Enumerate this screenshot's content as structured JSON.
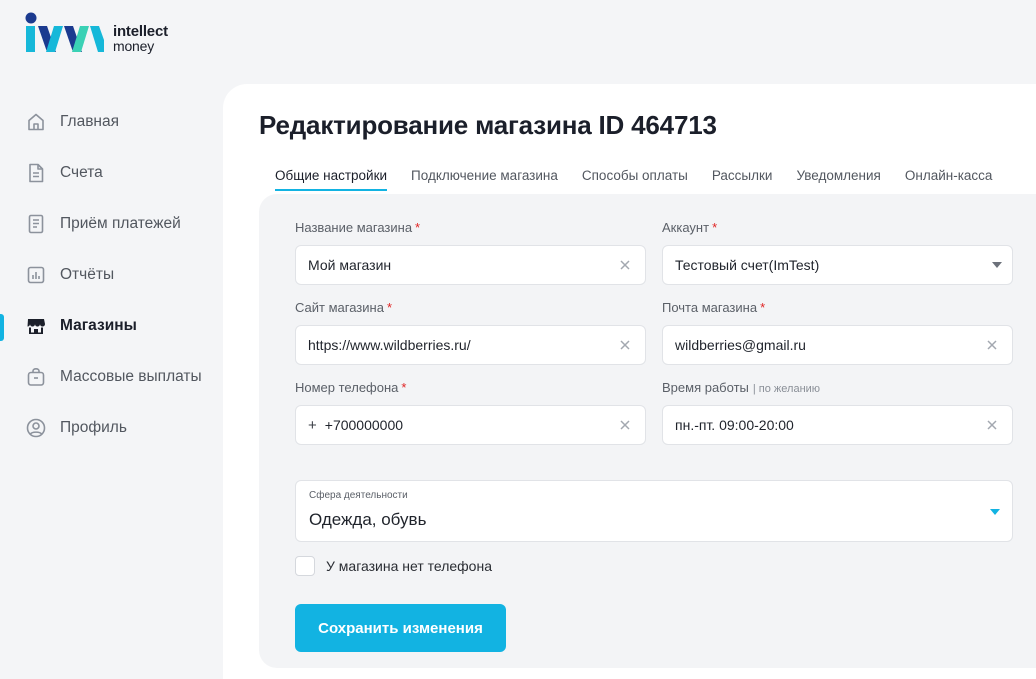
{
  "logo": {
    "line1": "intellect",
    "line2": "money"
  },
  "colors": {
    "accent": "#12b3e2",
    "required": "#e02424"
  },
  "sidebar": {
    "items": [
      {
        "label": "Главная",
        "icon": "home-icon"
      },
      {
        "label": "Счета",
        "icon": "document-icon"
      },
      {
        "label": "Приём платежей",
        "icon": "receipt-icon"
      },
      {
        "label": "Отчёты",
        "icon": "bar-chart-icon"
      },
      {
        "label": "Магазины",
        "icon": "store-icon",
        "active": true
      },
      {
        "label": "Массовые выплаты",
        "icon": "bag-icon"
      },
      {
        "label": "Профиль",
        "icon": "user-circle-icon"
      }
    ]
  },
  "page": {
    "title": "Редактирование магазина ID 464713"
  },
  "tabs": [
    {
      "label": "Общие настройки",
      "active": true
    },
    {
      "label": "Подключение магазина"
    },
    {
      "label": "Способы оплаты"
    },
    {
      "label": "Рассылки"
    },
    {
      "label": "Уведомления"
    },
    {
      "label": "Онлайн-касса"
    }
  ],
  "form": {
    "required_mark": "*",
    "shop_name": {
      "label": "Название магазина",
      "value": "Мой магазин"
    },
    "account": {
      "label": "Аккаунт",
      "value": "Тестовый счет(ImTest)"
    },
    "site": {
      "label": "Сайт магазина",
      "value": "https://www.wildberries.ru/"
    },
    "email": {
      "label": "Почта магазина",
      "value": "wildberries@gmail.ru"
    },
    "phone": {
      "label": "Номер телефона",
      "prefix": "+",
      "value": "+700000000"
    },
    "hours": {
      "label": "Время работы",
      "optional": "| по желанию",
      "value": "пн.-пт. 09:00-20:00"
    },
    "sphere": {
      "label": "Сфера деятельности",
      "value": "Одежда, обувь"
    },
    "no_phone": {
      "label": "У магазина нет телефона",
      "checked": false
    },
    "save_label": "Сохранить изменения"
  }
}
